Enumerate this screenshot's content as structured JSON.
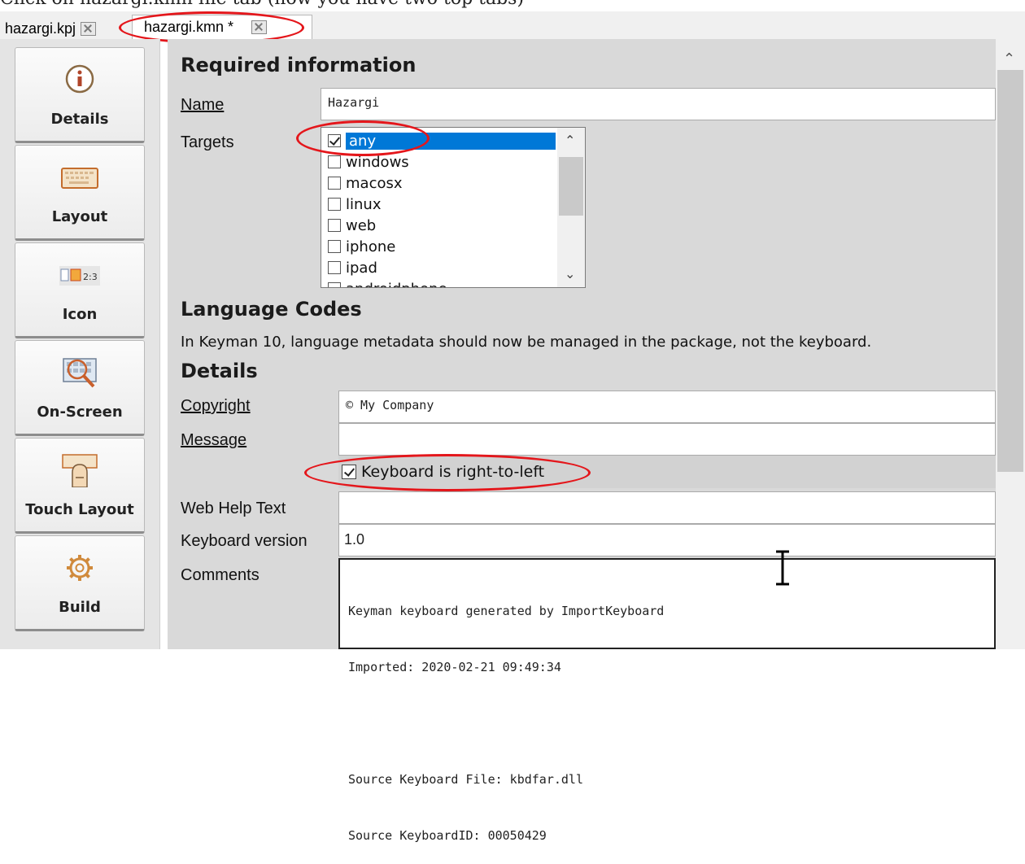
{
  "caption": "Click on hazargi.kmn file tab (now you have two top tabs)",
  "tabs": [
    {
      "label": "hazargi.kpj"
    },
    {
      "label": "hazargi.kmn *"
    }
  ],
  "sidebar": {
    "items": [
      {
        "label": "Details",
        "icon": "info-icon"
      },
      {
        "label": "Layout",
        "icon": "keyboard-icon"
      },
      {
        "label": "Icon",
        "icon": "icon-preview-icon",
        "icon_text": "2:3"
      },
      {
        "label": "On-Screen",
        "icon": "onscreen-keyboard-icon"
      },
      {
        "label": "Touch Layout",
        "icon": "touch-icon"
      },
      {
        "label": "Build",
        "icon": "gear-icon"
      }
    ]
  },
  "required": {
    "heading": "Required information",
    "name_label": "Name",
    "name_value": "Hazargi",
    "targets_label": "Targets",
    "targets": [
      {
        "label": "any",
        "checked": true,
        "selected": true
      },
      {
        "label": "windows",
        "checked": false
      },
      {
        "label": "macosx",
        "checked": false
      },
      {
        "label": "linux",
        "checked": false
      },
      {
        "label": "web",
        "checked": false
      },
      {
        "label": "iphone",
        "checked": false
      },
      {
        "label": "ipad",
        "checked": false
      },
      {
        "label": "androidphone",
        "checked": false
      }
    ]
  },
  "language": {
    "heading": "Language Codes",
    "note": "In Keyman 10, language metadata should now be managed in the package, not the keyboard."
  },
  "details": {
    "heading": "Details",
    "copyright_label": "Copyright",
    "copyright_value": "© My Company",
    "message_label": "Message",
    "message_value": "",
    "rtl_label": "Keyboard is right-to-left",
    "rtl_checked": true,
    "webhelp_label": "Web Help Text",
    "webhelp_value": "",
    "version_label": "Keyboard version",
    "version_value": "1.0",
    "comments_label": "Comments",
    "comments_lines": [
      "Keyman keyboard generated by ImportKeyboard",
      "Imported: 2020-02-21 09:49:34",
      "",
      "Source Keyboard File: kbdfar.dll",
      "Source KeyboardID: 00050429"
    ]
  },
  "colors": {
    "highlight_oval": "#e4161b",
    "selection": "#0078d7"
  }
}
